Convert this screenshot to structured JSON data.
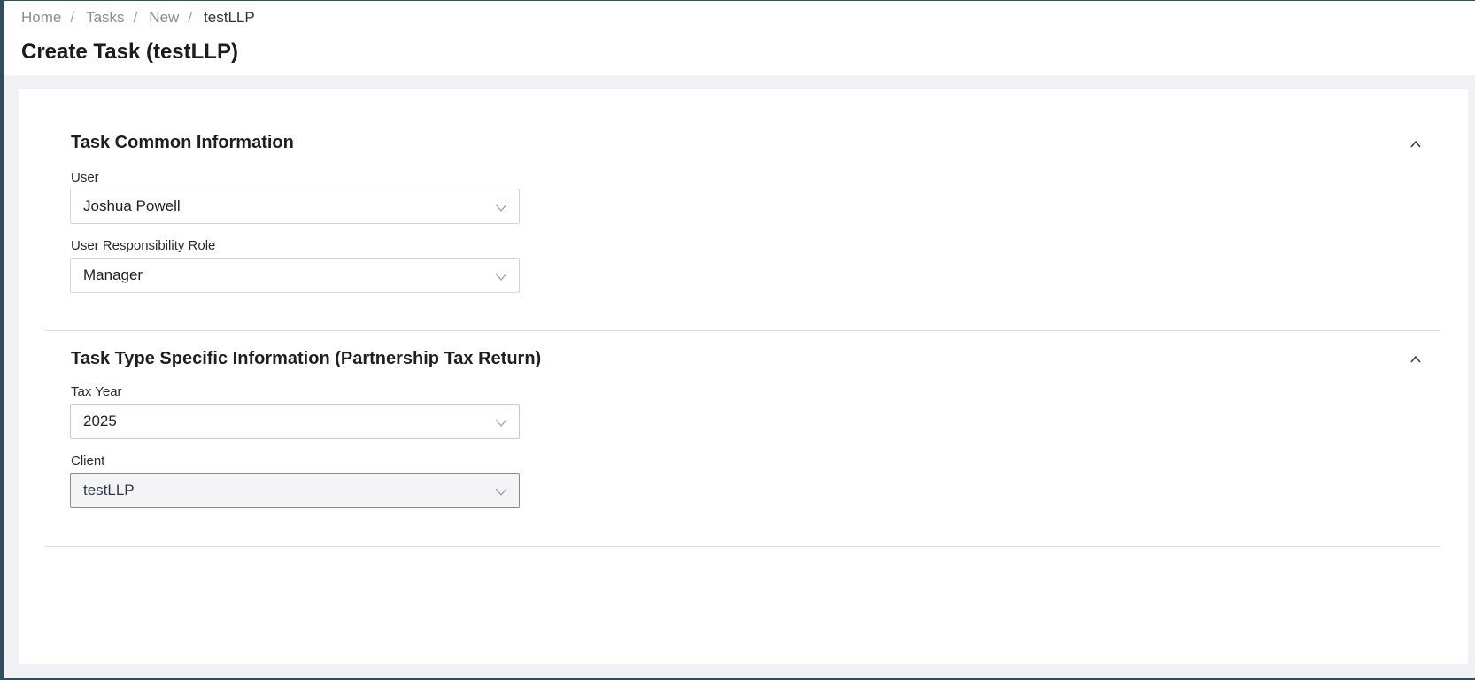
{
  "breadcrumb": {
    "items": [
      "Home",
      "Tasks",
      "New"
    ],
    "separator": "/",
    "current": "testLLP"
  },
  "page": {
    "title": "Create Task (testLLP)"
  },
  "sections": [
    {
      "title": "Task Common Information",
      "toggle_icon": "chevron-up-icon",
      "fields": [
        {
          "label": "User",
          "value": "Joshua Powell"
        },
        {
          "label": "User Responsibility Role",
          "value": "Manager"
        }
      ]
    },
    {
      "title": "Task Type Specific Information (Partnership Tax Return)",
      "toggle_icon": "chevron-up-icon",
      "fields": [
        {
          "label": "Tax Year",
          "value": "2025"
        },
        {
          "label": "Client",
          "value": "testLLP"
        }
      ]
    }
  ],
  "colors": {
    "frame_border": "#2d4f5f",
    "page_background": "#eff1f5",
    "card_background": "#ffffff"
  }
}
